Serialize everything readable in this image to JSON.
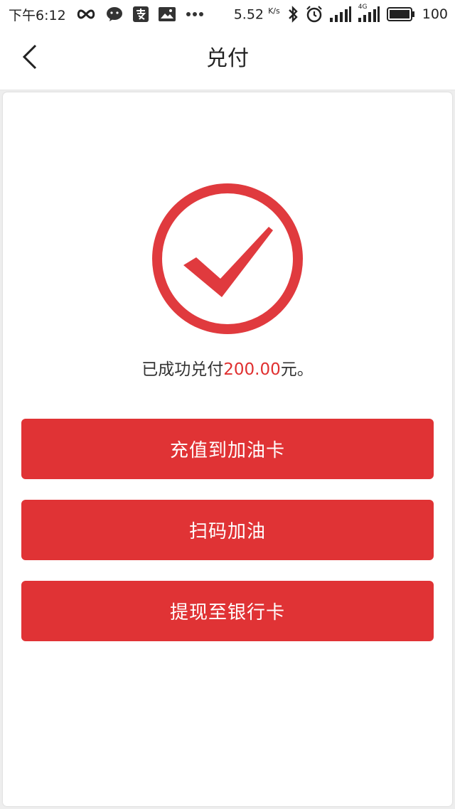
{
  "status_bar": {
    "time": "下午6:12",
    "speed_value": "5.52",
    "speed_unit": "K/s",
    "network_label": "4G",
    "battery": "100",
    "icons": [
      "infinity-icon",
      "wechat-icon",
      "alipay-icon",
      "image-icon",
      "more-dots-icon",
      "bluetooth-icon",
      "alarm-icon",
      "signal-icon",
      "signal-4g-icon",
      "battery-icon"
    ]
  },
  "nav": {
    "back_icon": "chevron-left-icon",
    "title": "兑付"
  },
  "result": {
    "icon": "check-circle-icon",
    "prefix": "已成功兑付",
    "amount": "200.00",
    "suffix": "元。"
  },
  "buttons": {
    "recharge_label": "充值到加油卡",
    "scan_label": "扫码加油",
    "withdraw_label": "提现至银行卡"
  },
  "colors": {
    "accent": "#e03335",
    "amount": "#e03030"
  }
}
